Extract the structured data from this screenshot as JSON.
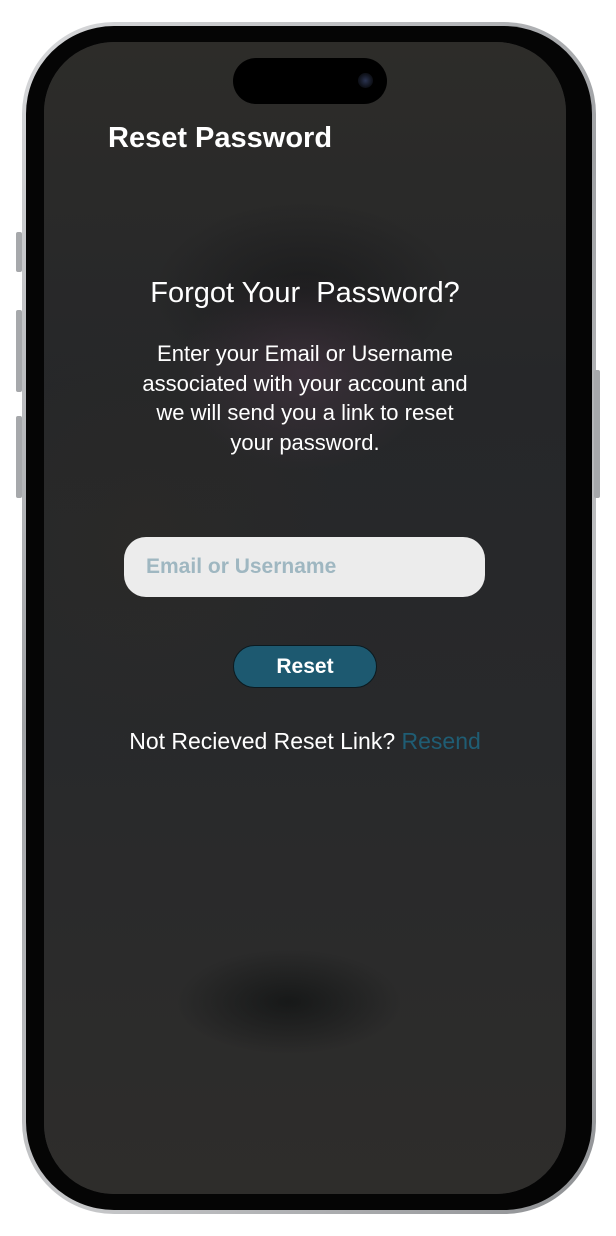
{
  "header": {
    "title": "Reset Password"
  },
  "main": {
    "heading": "Forgot Your  Password?",
    "description": "Enter your Email or Username associated with your account and we will send you a link to reset your password.",
    "email_input": {
      "value": "",
      "placeholder": "Email or Username"
    },
    "reset_button_label": "Reset",
    "resend_prompt": "Not Recieved Reset Link? ",
    "resend_link_label": "Resend"
  },
  "colors": {
    "accent": "#1d5970",
    "link": "#1f5d74",
    "input_background": "#ececec",
    "placeholder": "#9fb7c1",
    "screen_background": "#2a2b2d"
  },
  "icons": {
    "camera": "front-camera-icon"
  }
}
